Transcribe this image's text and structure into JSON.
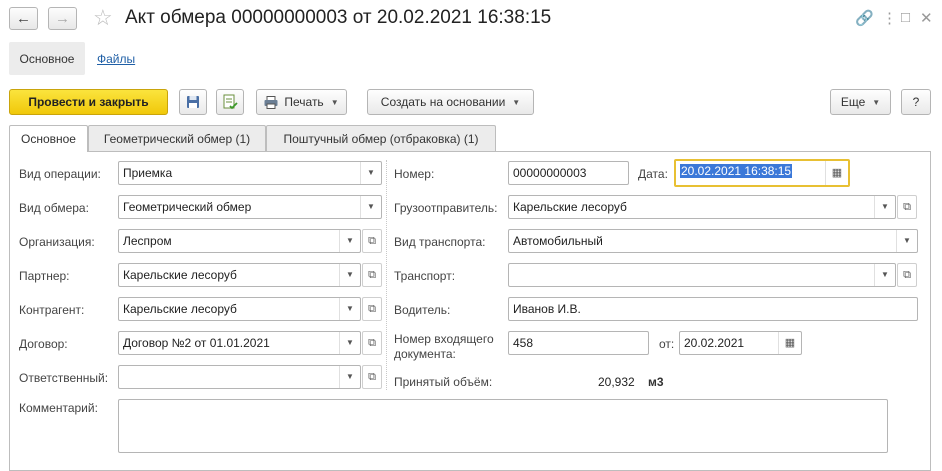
{
  "window": {
    "title": "Акт обмера 00000000003 от 20.02.2021 16:38:15",
    "back_icon": "arrow-left-icon",
    "forward_icon": "arrow-right-icon",
    "favorite_icon": "star-icon",
    "link_icon": "link-icon",
    "more_icon": "vertical-dots-icon",
    "maximize_icon": "square-icon",
    "close_icon": "close-icon"
  },
  "sections": {
    "main": "Основное",
    "files": "Файлы"
  },
  "toolbar": {
    "post_close": "Провести и закрыть",
    "save_icon": "floppy-disk-icon",
    "post_icon": "document-post-icon",
    "print": "Печать",
    "create_based": "Создать на основании",
    "more": "Еще",
    "help": "?"
  },
  "tabs": [
    "Основное",
    "Геометрический обмер (1)",
    "Поштучный обмер (отбраковка) (1)"
  ],
  "form": {
    "operation_type": {
      "label": "Вид операции:",
      "value": "Приемка"
    },
    "measure_type": {
      "label": "Вид обмера:",
      "value": "Геометрический обмер"
    },
    "organization": {
      "label": "Организация:",
      "value": "Леспром"
    },
    "partner": {
      "label": "Партнер:",
      "value": "Карельские лесоруб"
    },
    "counterparty": {
      "label": "Контрагент:",
      "value": "Карельские лесоруб"
    },
    "contract": {
      "label": "Договор:",
      "value": "Договор №2 от 01.01.2021"
    },
    "responsible": {
      "label": "Ответственный:",
      "value": ""
    },
    "comment": {
      "label": "Комментарий:",
      "value": ""
    },
    "number": {
      "label": "Номер:",
      "value": "00000000003"
    },
    "date": {
      "label": "Дата:",
      "value": "20.02.2021 16:38:15"
    },
    "shipper": {
      "label": "Грузоотправитель:",
      "value": "Карельские лесоруб"
    },
    "transport_type": {
      "label": "Вид транспорта:",
      "value": "Автомобильный"
    },
    "transport": {
      "label": "Транспорт:",
      "value": ""
    },
    "driver": {
      "label": "Водитель:",
      "value": "Иванов И.В."
    },
    "incoming_doc": {
      "label_line1": "Номер входящего",
      "label_line2": "документа:",
      "value": "458"
    },
    "incoming_date": {
      "label": "от:",
      "value": "20.02.2021"
    },
    "accepted_volume": {
      "label": "Принятый объём:",
      "value": "20,932",
      "unit": "м3"
    }
  }
}
